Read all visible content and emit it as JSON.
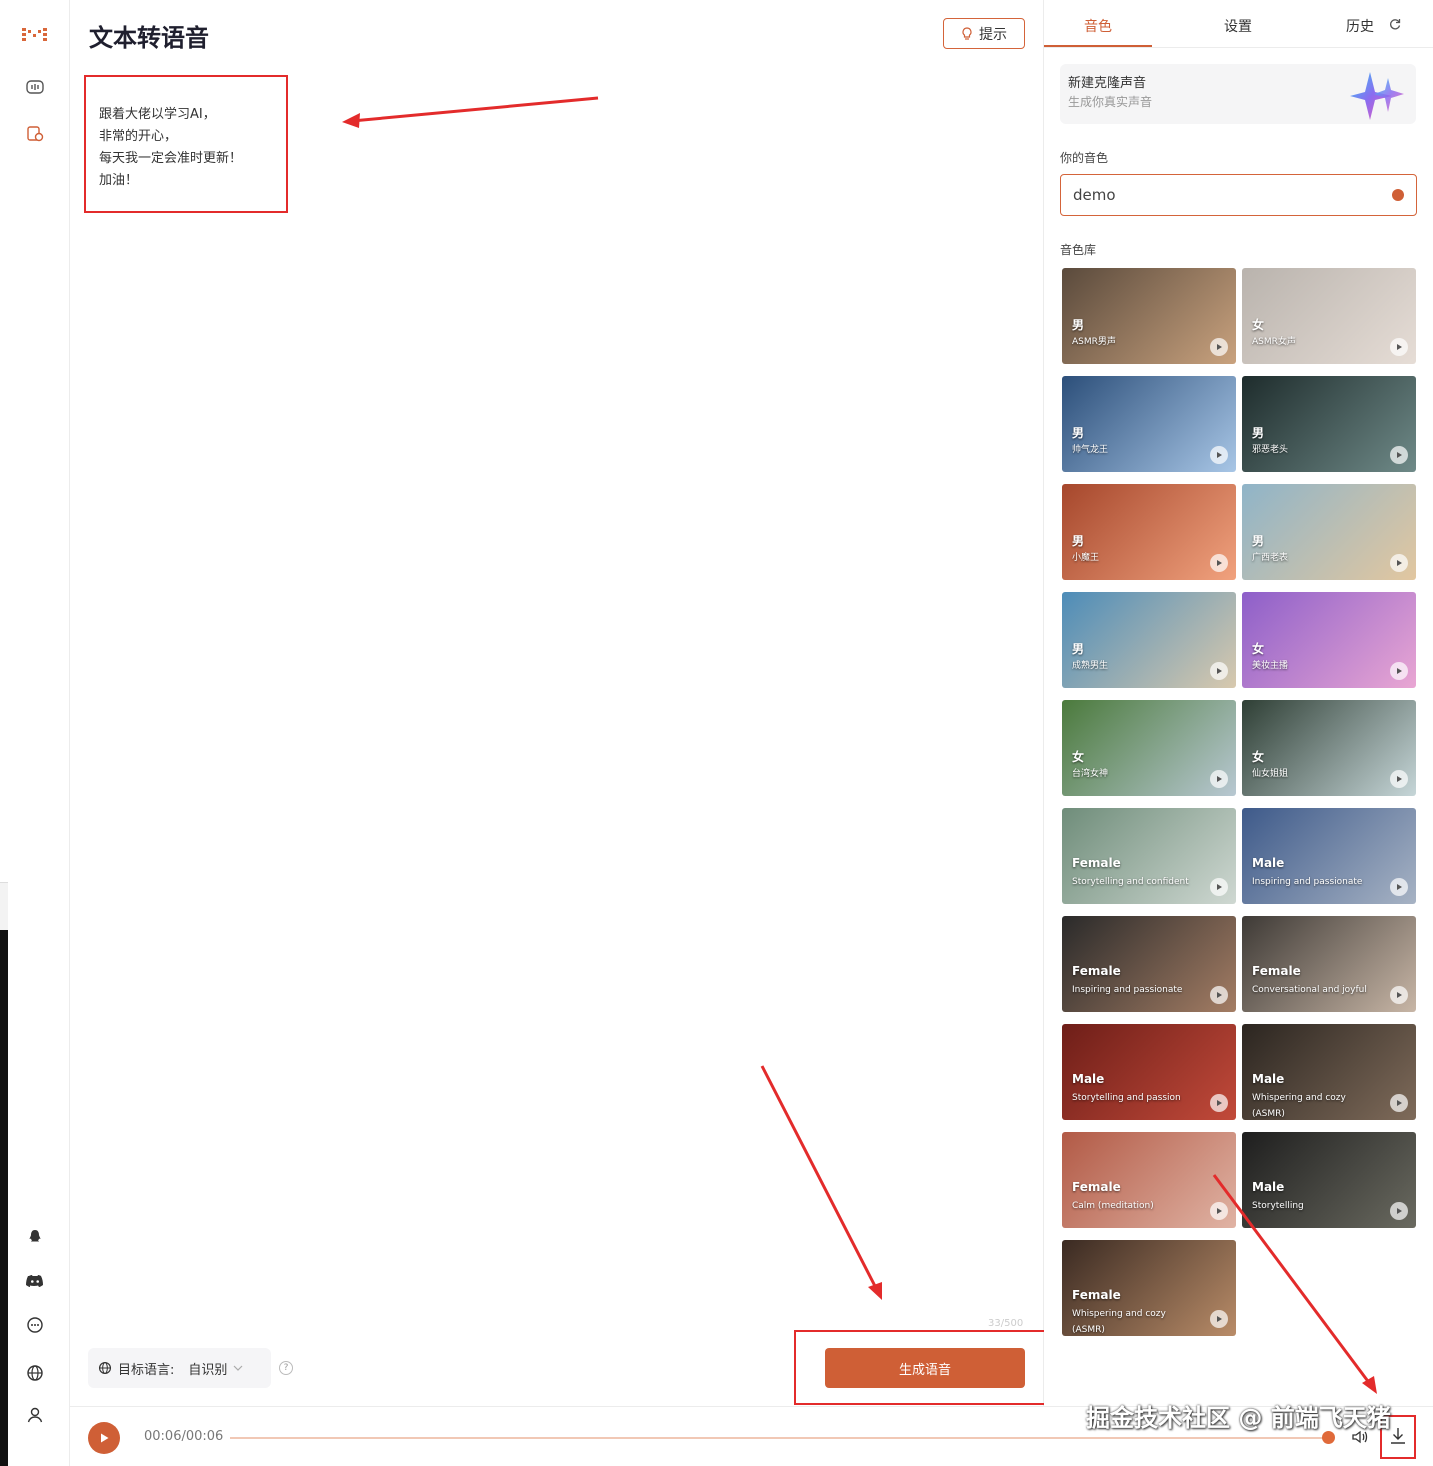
{
  "page": {
    "title": "文本转语音",
    "tip_label": "提示"
  },
  "editor": {
    "lines": [
      "跟着大佬以学习AI，",
      "非常的开心，",
      "每天我一定会准时更新！",
      "加油！"
    ],
    "counter": "33/500"
  },
  "language": {
    "label": "目标语言:",
    "value": "自识别"
  },
  "generate_label": "生成语音",
  "player": {
    "time": "00:06/00:06",
    "progress": 1.0
  },
  "watermark": "掘金技术社区 @ 前端飞天猪",
  "right_panel": {
    "tabs": [
      "音色",
      "设置",
      "历史"
    ],
    "clone": {
      "title": "新建克隆声音",
      "subtitle": "生成你真实声音"
    },
    "your_voice_label": "你的音色",
    "selected_voice": "demo",
    "library_label": "音色库",
    "voices": [
      {
        "gender": "男",
        "desc": "ASMR男声",
        "colors": [
          "#5a4a3c",
          "#c9a27e"
        ]
      },
      {
        "gender": "女",
        "desc": "ASMR女声",
        "colors": [
          "#b9b3ad",
          "#e6ddd6"
        ]
      },
      {
        "gender": "男",
        "desc": "帅气龙王",
        "colors": [
          "#2c4f7a",
          "#a8c6e6"
        ]
      },
      {
        "gender": "男",
        "desc": "邪恶老头",
        "colors": [
          "#1e2c2c",
          "#6f8a88"
        ]
      },
      {
        "gender": "男",
        "desc": "小魔王",
        "colors": [
          "#a6472c",
          "#f1a27e"
        ]
      },
      {
        "gender": "男",
        "desc": "广西老表",
        "colors": [
          "#8fb4c8",
          "#e2c7a0"
        ]
      },
      {
        "gender": "男",
        "desc": "成熟男生",
        "colors": [
          "#4d8cb8",
          "#d8c9ae"
        ]
      },
      {
        "gender": "女",
        "desc": "美妆主播",
        "colors": [
          "#8d5fc9",
          "#e9a6d3"
        ]
      },
      {
        "gender": "女",
        "desc": "台湾女神",
        "colors": [
          "#4b7a3c",
          "#b8c8d2"
        ]
      },
      {
        "gender": "女",
        "desc": "仙女姐姐",
        "colors": [
          "#2f3f35",
          "#c6d6d8"
        ]
      },
      {
        "gender": "Female",
        "desc": "Storytelling and confident",
        "colors": [
          "#6f8d7a",
          "#cfd8d2"
        ]
      },
      {
        "gender": "Male",
        "desc": "Inspiring and passionate",
        "colors": [
          "#3e5a8a",
          "#a7b3c4"
        ]
      },
      {
        "gender": "Female",
        "desc": "Inspiring and passionate",
        "colors": [
          "#2a2a2a",
          "#a47d64"
        ]
      },
      {
        "gender": "Female",
        "desc": "Conversational and joyful",
        "colors": [
          "#3e3a36",
          "#c8b6a6"
        ]
      },
      {
        "gender": "Male",
        "desc": "Storytelling and passion",
        "colors": [
          "#6e1e18",
          "#c24a3a"
        ]
      },
      {
        "gender": "Male",
        "desc": "Whispering and cozy (ASMR)",
        "colors": [
          "#2b2520",
          "#7f6b5a"
        ]
      },
      {
        "gender": "Female",
        "desc": "Calm (meditation)",
        "colors": [
          "#b25a46",
          "#e0b3a4"
        ]
      },
      {
        "gender": "Male",
        "desc": "Storytelling",
        "colors": [
          "#1e1e1e",
          "#6a6a60"
        ]
      },
      {
        "gender": "Female",
        "desc": "Whispering and cozy (ASMR)",
        "colors": [
          "#3a2a22",
          "#b98c68"
        ]
      }
    ]
  },
  "colors": {
    "accent": "#cf5f36",
    "annotation": "#e32b2b"
  }
}
